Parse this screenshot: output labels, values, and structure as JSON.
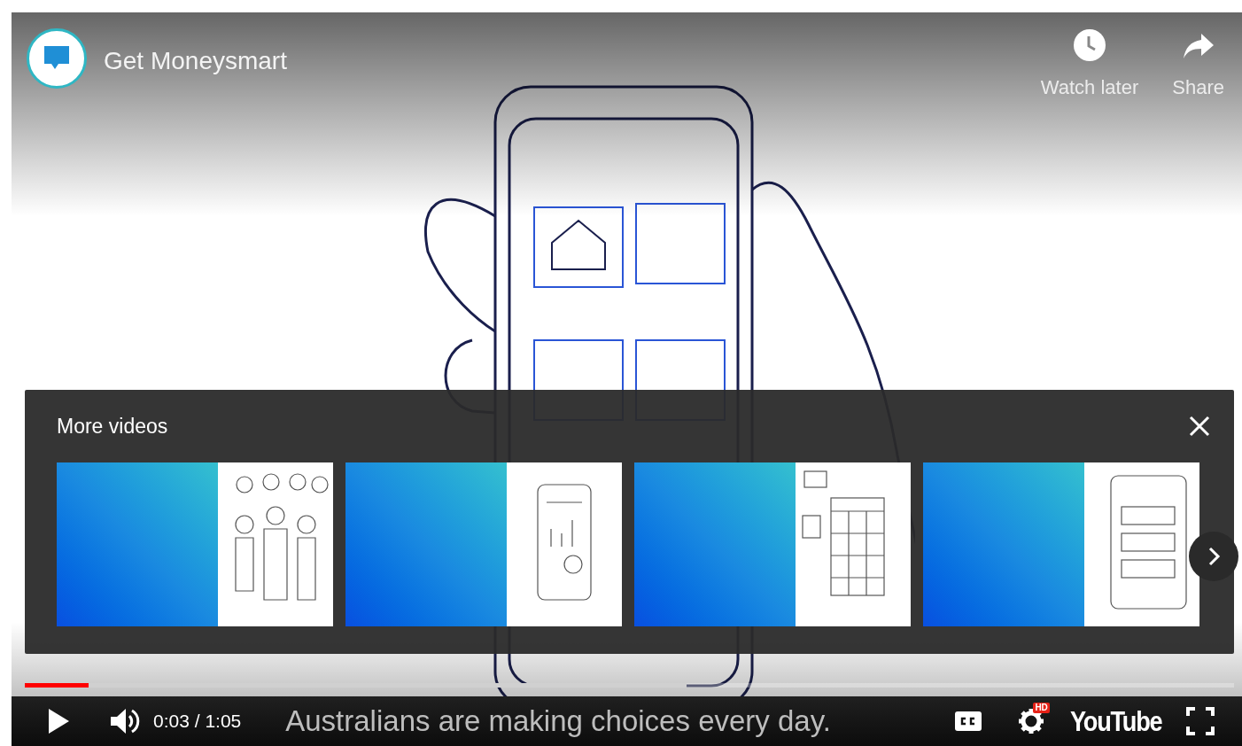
{
  "channel": {
    "name": "Get Moneysmart"
  },
  "top_actions": [
    {
      "kind": "watch_later",
      "label": "Watch later"
    },
    {
      "kind": "share",
      "label": "Share"
    }
  ],
  "more_videos": {
    "title": "More videos",
    "cards": [
      {
        "kind": "people"
      },
      {
        "kind": "phone_chart"
      },
      {
        "kind": "calendar"
      },
      {
        "kind": "accounts"
      }
    ]
  },
  "progress": {
    "played": {
      "level": 0.053
    },
    "loaded": {
      "level": 0.547
    }
  },
  "controls": {
    "playing": false,
    "time": "0:03 / 1:05",
    "caption": "Australians are making choices every day.",
    "hd_badge": "HD",
    "brand": "YouTube"
  }
}
